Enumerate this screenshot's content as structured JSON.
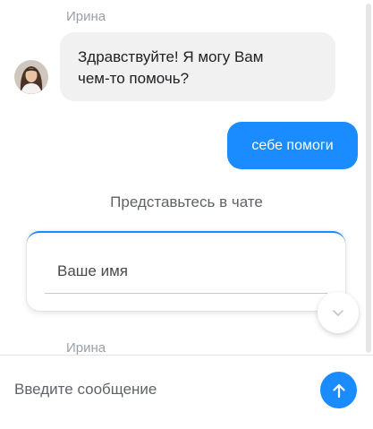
{
  "colors": {
    "accent": "#1a8cff",
    "incoming_bubble": "#f1f1f1",
    "sender_name": "#9aa0a6"
  },
  "messages": [
    {
      "sender": "Ирина",
      "direction": "incoming",
      "text_line1": "Здравствуйте! Я могу Вам",
      "text_line2": "чем-то помочь?"
    },
    {
      "direction": "outgoing",
      "text": "себе помоги"
    }
  ],
  "intro_form": {
    "title": "Представьтесь в чате",
    "name_placeholder": "Ваше имя"
  },
  "next_sender": "Ирина",
  "composer": {
    "placeholder": "Введите сообщение"
  },
  "icons": {
    "scroll_down": "chevron-down-icon",
    "send": "arrow-up-icon",
    "avatar": "agent-avatar"
  }
}
